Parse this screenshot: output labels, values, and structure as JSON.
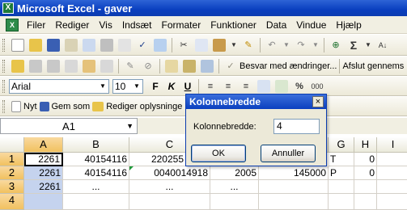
{
  "window": {
    "title": "Microsoft Excel - gaver"
  },
  "menu": [
    "Filer",
    "Rediger",
    "Vis",
    "Indsæt",
    "Formater",
    "Funktioner",
    "Data",
    "Vindue",
    "Hjælp"
  ],
  "toolbar_review": {
    "reply_label": "Besvar med ændringer...",
    "end_label": "Afslut gennems"
  },
  "format_toolbar": {
    "font": "Arial",
    "size": "10",
    "bold": "F",
    "italic": "K",
    "underline": "U"
  },
  "save_toolbar": {
    "new_label": "Nyt",
    "save_as_label": "Gem som",
    "edit_info_label": "Rediger oplysninge"
  },
  "namebox": {
    "value": "A1"
  },
  "formula_bar": {
    "fx": "fx"
  },
  "columns": [
    "A",
    "B",
    "C",
    "D",
    "E",
    "F",
    "G",
    "H",
    "I"
  ],
  "rows": [
    {
      "num": "1",
      "A": "2261",
      "B": "40154116",
      "C": "220255",
      "F": "",
      "G": "T",
      "H": "0"
    },
    {
      "num": "2",
      "A": "2261",
      "B": "40154116",
      "C": "0040014918",
      "E": "2005",
      "F": "145000",
      "G": "P",
      "H": "0"
    },
    {
      "num": "3",
      "A": "2261",
      "B": "...",
      "C": "...",
      "E": "..."
    },
    {
      "num": "4",
      "A": ""
    }
  ],
  "dialog": {
    "title": "Kolonnebredde",
    "close": "×",
    "field_label": "Kolonnebredde:",
    "field_value": "4",
    "ok_label": "OK",
    "cancel_label": "Annuller"
  }
}
